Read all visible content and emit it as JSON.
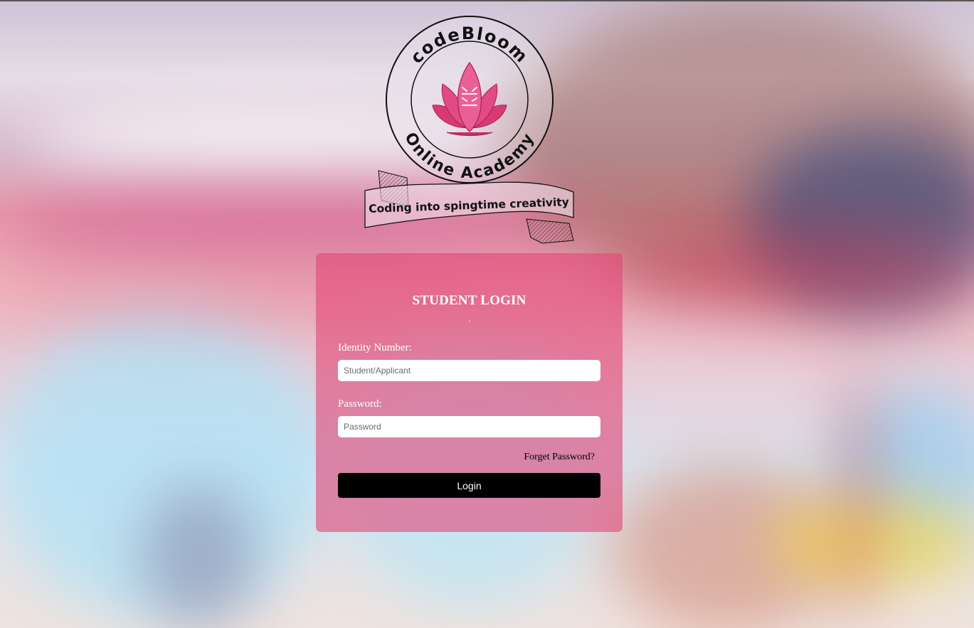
{
  "logo": {
    "brand_name": "codeBloom",
    "subtitle": "Online Academy",
    "tagline": "Coding into spingtime creativity",
    "icon": "lotus-icon"
  },
  "login": {
    "title": "STUDENT LOGIN",
    "identity_label": "Identity Number:",
    "identity_placeholder": "Student/Applicant",
    "identity_value": "",
    "password_label": "Password:",
    "password_placeholder": "Password",
    "password_value": "",
    "forgot_label": "Forget Password?",
    "login_label": "Login"
  },
  "colors": {
    "card": "#e24878",
    "button": "#000000",
    "lotus": "#e0457f"
  }
}
